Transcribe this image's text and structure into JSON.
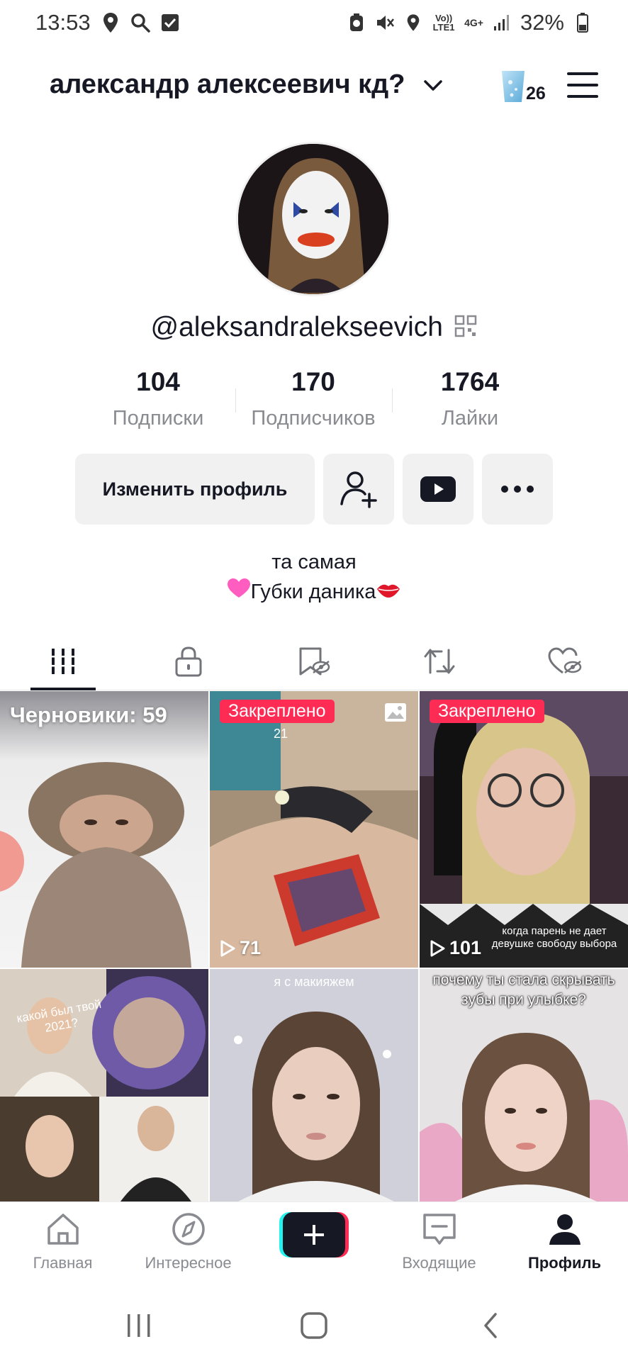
{
  "status_bar": {
    "time": "13:53",
    "battery": "32%",
    "network": "4G+",
    "volte": "Vo)) LTE1"
  },
  "header": {
    "title": "александр алексеевич кд?",
    "coins": "26"
  },
  "profile": {
    "handle": "@aleksandralekseevich",
    "stats": [
      {
        "value": "104",
        "label": "Подписки"
      },
      {
        "value": "170",
        "label": "Подписчиков"
      },
      {
        "value": "1764",
        "label": "Лайки"
      }
    ],
    "edit_button": "Изменить профиль",
    "bio_line1": "та самая",
    "bio_line2": "Губки даника"
  },
  "tabs": [
    "videos-grid",
    "private",
    "favorites-hidden",
    "reposts",
    "liked-hidden"
  ],
  "grid": {
    "drafts": "Черновики: 59",
    "pinned_label": "Закреплено",
    "cells": [
      {
        "type": "drafts"
      },
      {
        "label": "Закреплено",
        "views": "71",
        "caption_top": "21"
      },
      {
        "label": "Закреплено",
        "views": "101",
        "caption_bottom": "когда парень не дает девушке свободу выбора"
      },
      {
        "caption": "какой был твой 2021?"
      },
      {
        "caption": "я с макияжем"
      },
      {
        "caption": "почему ты стала скрывать зубы при улыбке?"
      }
    ]
  },
  "bottom_nav": {
    "home": "Главная",
    "discover": "Интересное",
    "inbox": "Входящие",
    "profile": "Профиль"
  },
  "colors": {
    "accent": "#fe2c55",
    "text": "#161823",
    "muted": "#8a8b91",
    "button_bg": "#f1f1f2"
  }
}
